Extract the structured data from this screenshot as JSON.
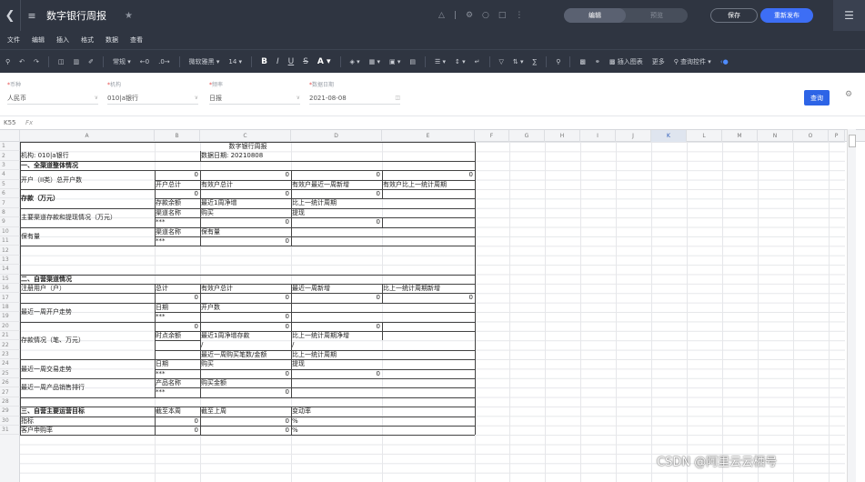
{
  "window": {
    "title": "数字银行周报",
    "mode_tabs": [
      "编辑",
      "预览"
    ],
    "save_label": "保存",
    "publish_label": "重新发布"
  },
  "menubar": [
    "文件",
    "编辑",
    "插入",
    "格式",
    "数据",
    "查看"
  ],
  "toolbar": {
    "format_label": "常规",
    "font_name": "微软雅黑",
    "font_size": "14",
    "insert_chart": "插入图表",
    "more": "更多",
    "query_control": "查询控件"
  },
  "filters": [
    {
      "label": "币种",
      "value": "人民币"
    },
    {
      "label": "机构",
      "value": "010|a银行"
    },
    {
      "label": "频率",
      "value": "日报"
    },
    {
      "label": "数据日期",
      "value": "2021-08-08"
    }
  ],
  "query_button": "查询",
  "cell_ref": "K55",
  "fx": "Fx",
  "columns": [
    "A",
    "B",
    "C",
    "D",
    "E",
    "F",
    "G",
    "H",
    "I",
    "J",
    "K",
    "L",
    "M",
    "N",
    "O",
    "P"
  ],
  "rows": [
    "1",
    "2",
    "3",
    "4",
    "5",
    "6",
    "7",
    "8",
    "9",
    "10",
    "11",
    "12",
    "13",
    "14",
    "15",
    "16",
    "17",
    "18",
    "19",
    "20",
    "21",
    "22",
    "23",
    "24",
    "25",
    "26",
    "27",
    "28",
    "29",
    "30",
    "31"
  ],
  "report": {
    "title": "数字银行周报",
    "org": "机构: 010|a银行",
    "date": "数据日期: 20210808",
    "s1": "一、全渠道整体情况",
    "r4_label": "开户（II类）总开户数",
    "zero": "0",
    "stars": "***",
    "r5": [
      "开户总计",
      "有效户总计",
      "有效户最近一周新增",
      "有效户比上一统计周期"
    ],
    "r6_label": "存款（万元）",
    "r7": [
      "存款余额",
      "最近1周净增",
      "比上一统计周期"
    ],
    "r8_label": "主要渠道存款和提现情况（万元）",
    "r8": [
      "渠道名称",
      "购买",
      "提现"
    ],
    "r10_label": "保有量",
    "r10": [
      "渠道名称",
      "保有量"
    ],
    "s2": "二、自营渠道情况",
    "r16_label": "注册用户（户）",
    "r16": [
      "总计",
      "有效户总计",
      "最近一周新增",
      "比上一统计周期新增"
    ],
    "r18_label": "最近一周开户走势",
    "r18": [
      "日期",
      "开户数"
    ],
    "r21_label": "存款情况（笔、万元）",
    "r21": [
      "时点余额",
      "最近1周净增存款",
      "比上一统计周期净增"
    ],
    "slash": "/",
    "r23": [
      "最近一周购买笔数/金额",
      "比上一统计周期"
    ],
    "r24_label": "最近一周交易走势",
    "r24": [
      "日期",
      "购买",
      "提现"
    ],
    "r26_label": "最近一周产品销售排行",
    "r26": [
      "产品名称",
      "购买金额"
    ],
    "s3": "三、自营主要运营目标",
    "r29": [
      "截至本周",
      "截至上周",
      "变动率"
    ],
    "r30_label": "指标",
    "r31_label": "客户申购率",
    "pct": "%"
  },
  "watermark": "CSDN @阿里云云栖号"
}
